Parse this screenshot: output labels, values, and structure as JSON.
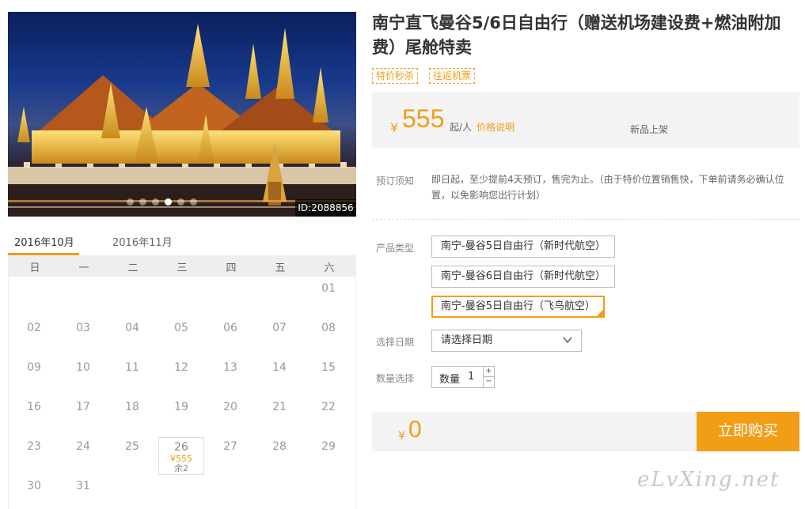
{
  "photo": {
    "id_label": "ID:2088856",
    "slide_count": 6,
    "active_slide": 3
  },
  "calendar": {
    "tabs": [
      "2016年10月",
      "2016年11月"
    ],
    "active_tab": 0,
    "weekdays": [
      "日",
      "一",
      "二",
      "三",
      "四",
      "五",
      "六"
    ],
    "days": [
      "01",
      "02",
      "03",
      "04",
      "05",
      "06",
      "07",
      "08",
      "09",
      "10",
      "11",
      "12",
      "13",
      "14",
      "15",
      "16",
      "17",
      "18",
      "19",
      "20",
      "21",
      "22",
      "23",
      "24",
      "25",
      "26",
      "27",
      "28",
      "29",
      "30",
      "31"
    ],
    "first_weekday": 6,
    "available": {
      "day": "26",
      "price": "¥555",
      "stock": "余2"
    }
  },
  "product": {
    "title": "南宁直飞曼谷5/6日自由行（赠送机场建设费+燃油附加费）尾舱特卖",
    "tags": [
      "特价秒杀",
      "往返机票"
    ],
    "price": {
      "currency": "¥",
      "amount": "555",
      "unit": "起/人",
      "note": "价格说明",
      "badge": "新品上架"
    }
  },
  "booking": {
    "notice_label": "预订须知",
    "notice_text": "即日起，至少提前4天预订，售完为止。（由于特价位置销售快，下单前请务必确认位置，以免影响您出行计划）",
    "type_label": "产品类型",
    "types": [
      "南宁-曼谷5日自由行（新时代航空）",
      "南宁-曼谷6日自由行（新时代航空）",
      "南宁-曼谷5日自由行（飞鸟航空）"
    ],
    "selected_type": 2,
    "date_label": "选择日期",
    "date_placeholder": "请选择日期",
    "qty_label_row": "数量选择",
    "qty_label": "数量",
    "qty_value": "1",
    "qty_plus": "+",
    "qty_minus": "−"
  },
  "total": {
    "currency": "¥",
    "amount": "0",
    "buy_label": "立即购买"
  },
  "watermark": "eLvXing.net",
  "colors": {
    "accent": "#f29d16",
    "panel_bg": "#f3f3f3"
  }
}
